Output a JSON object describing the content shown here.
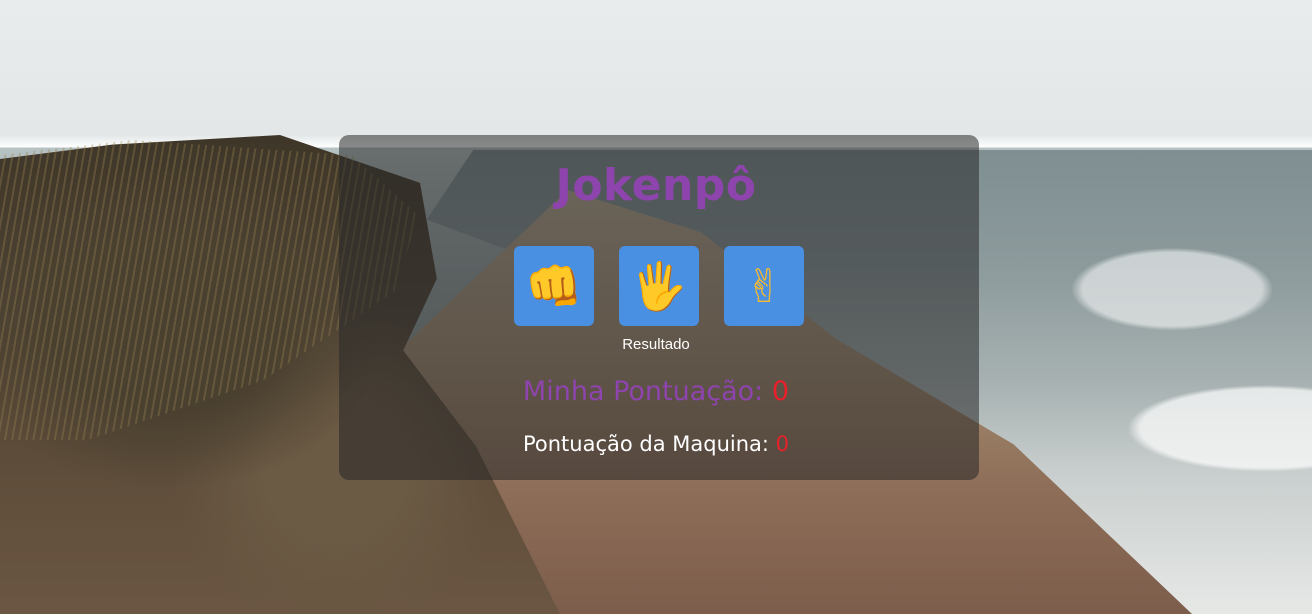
{
  "game": {
    "title": "Jokenpô",
    "choices": [
      {
        "name": "pedra",
        "icon": "fist-icon",
        "glyph": "👊"
      },
      {
        "name": "papel",
        "icon": "hand-icon",
        "glyph": "🖐"
      },
      {
        "name": "tesoura",
        "icon": "victory-hand-icon",
        "glyph": "✌"
      }
    ],
    "result_label": "Resultado",
    "my_score_label": "Minha Pontuação:",
    "my_score_value": "0",
    "machine_score_label": "Pontuação da Maquina:",
    "machine_score_value": "0"
  },
  "colors": {
    "title": "#8e44ad",
    "button": "#4a90e2",
    "score_value": "#e8202a"
  }
}
